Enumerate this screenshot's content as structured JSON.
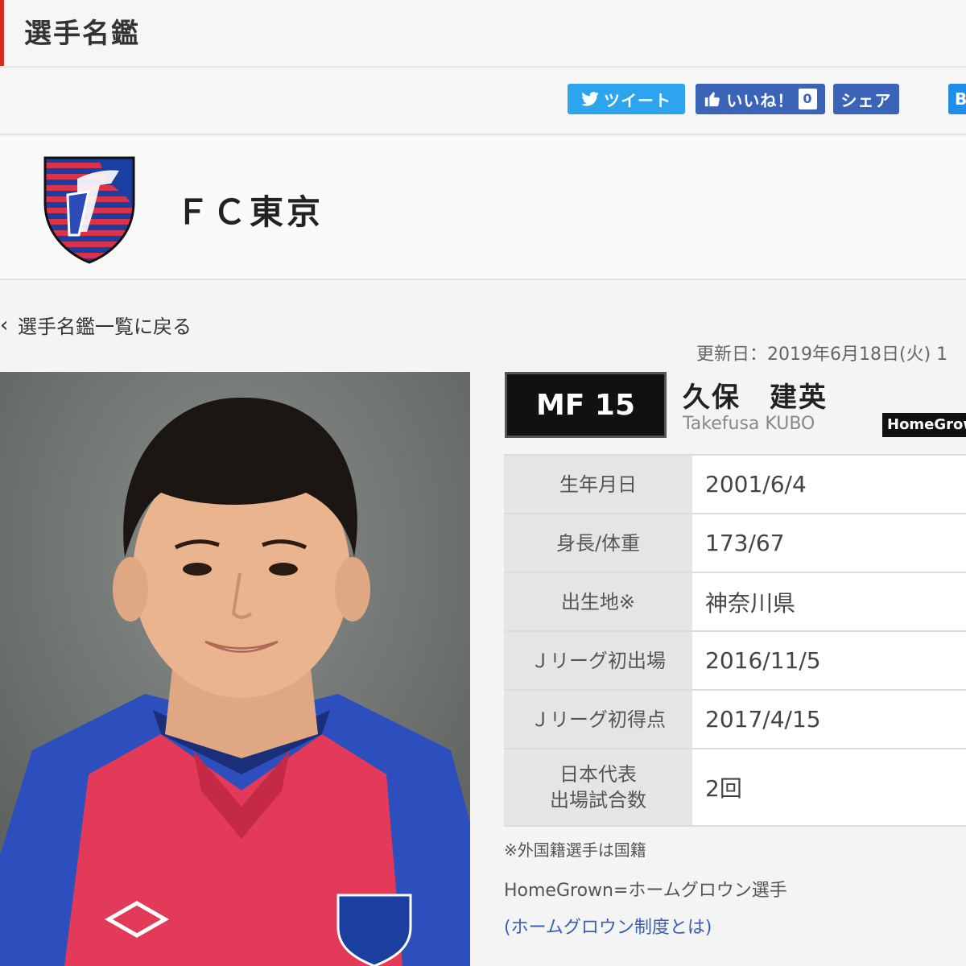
{
  "header": {
    "title": "選手名鑑"
  },
  "share": {
    "tweet_label": "ツイート",
    "like_label": "いいね！",
    "like_count": "0",
    "share_label": "シェア",
    "hatena_label": "B"
  },
  "club": {
    "name": "ＦＣ東京"
  },
  "nav": {
    "back_label": "選手名鑑一覧に戻る",
    "back_icon": "chevron-left-icon"
  },
  "updated": "更新日：2019年6月18日(火) 1",
  "player": {
    "position_number": "MF 15",
    "name_ja": "久保　建英",
    "name_en": "Takefusa KUBO",
    "badge": "HomeGrown"
  },
  "profile": [
    {
      "label": "生年月日",
      "value": "2001/6/4"
    },
    {
      "label": "身長/体重",
      "value": "173/67"
    },
    {
      "label": "出生地※",
      "value": "神奈川県"
    },
    {
      "label": "Ｊリーグ初出場",
      "value": "2016/11/5"
    },
    {
      "label": "Ｊリーグ初得点",
      "value": "2017/4/15"
    },
    {
      "label": "日本代表\n出場試合数",
      "value": "2回"
    }
  ],
  "notes": {
    "foreign": "※外国籍選手は国籍",
    "homegrown": "HomeGrown=ホームグロウン選手",
    "link": "(ホームグロウン制度とは)"
  },
  "colors": {
    "accent": "#d52b1e",
    "twitter": "#2da4ee",
    "facebook": "#3b64b8",
    "club_blue": "#1b3fa0",
    "club_red": "#d8334a"
  }
}
